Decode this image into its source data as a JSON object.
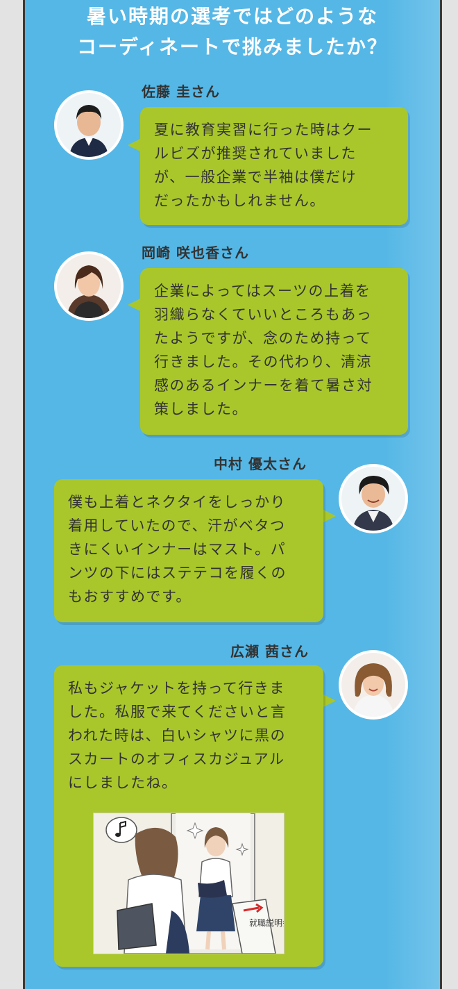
{
  "title": {
    "line1": "暑い時期の選考ではどのような",
    "line2": "コーディネートで挑みましたか？"
  },
  "entries": [
    {
      "name": "佐藤 圭さん",
      "lines": [
        "夏に教育実習に行った時はクー",
        "ルビズが推奨されていました",
        "が、一般企業で半袖は僕だけ",
        "だったかもしれません。"
      ]
    },
    {
      "name": "岡崎 咲也香さん",
      "lines": [
        "企業によってはスーツの上着を",
        "羽織らなくていいところもあっ",
        "たようですが、念のため持って",
        "行きました。その代わり、清涼",
        "感のあるインナーを着て暑さ対",
        "策しました。"
      ]
    },
    {
      "name": "中村 優太さん",
      "lines": [
        "僕も上着とネクタイをしっかり",
        "着用していたので、汗がベタつ",
        "きにくいインナーはマスト。パ",
        "ンツの下にはステテコを履くの",
        "もおすすめです。"
      ]
    },
    {
      "name": "広瀬 茜さん",
      "lines": [
        "私もジャケットを持って行きま",
        "した。私服で来てくださいと言",
        "われた時は、白いシャツに黒の",
        "スカートのオフィスカジュアル",
        "にしましたね。"
      ]
    }
  ],
  "illustration": {
    "sign_text": "就職説明会場",
    "note_icon": "music-note-icon"
  },
  "colors": {
    "panel": "#55b7e6",
    "bubble": "#a9c72a",
    "title_text": "#ffffff"
  }
}
